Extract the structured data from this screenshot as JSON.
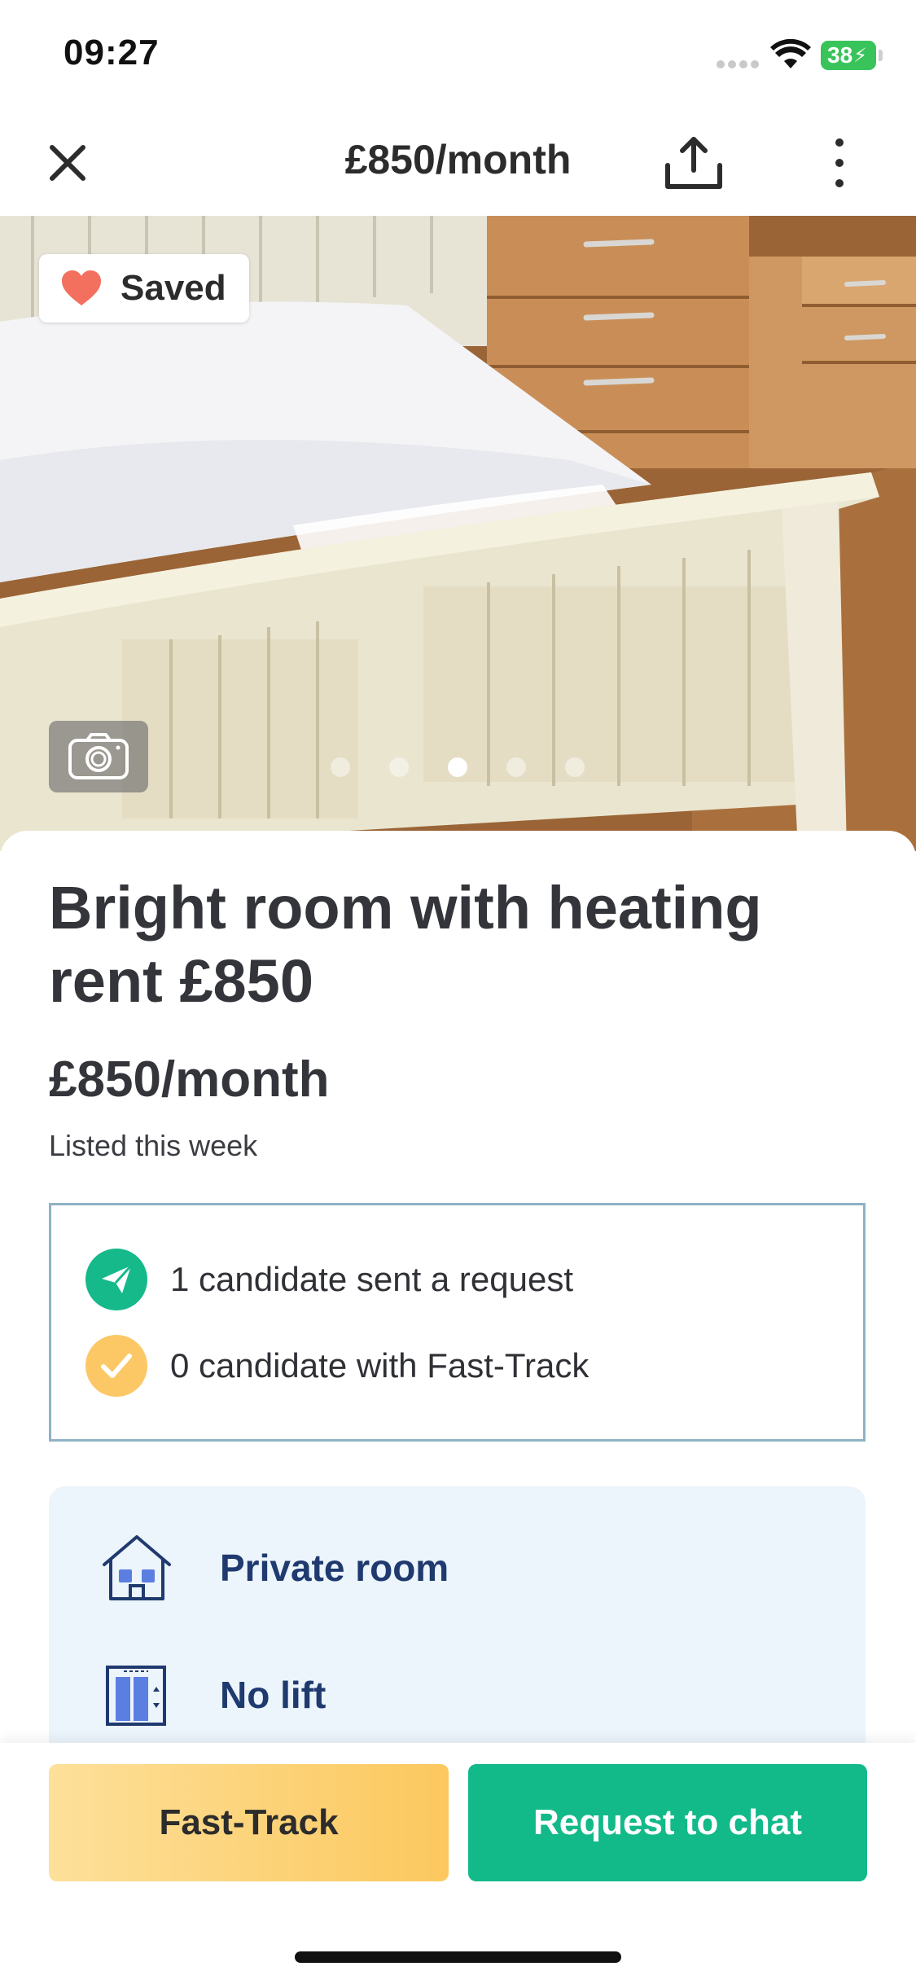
{
  "status_bar": {
    "time": "09:27",
    "battery": "38"
  },
  "header": {
    "title": "£850/month"
  },
  "photo": {
    "saved_label": "Saved",
    "slide_count": 5,
    "active_slide": 3
  },
  "listing": {
    "title": "Bright room with heating rent £850",
    "price": "£850/month",
    "listed": "Listed this week"
  },
  "candidates": [
    {
      "icon": "paper-plane-icon",
      "text": "1 candidate sent a request"
    },
    {
      "icon": "checkmark-icon",
      "text": "0 candidate with Fast-Track"
    }
  ],
  "features": [
    {
      "icon": "house-icon",
      "label": "Private room"
    },
    {
      "icon": "lift-icon",
      "label": "No lift"
    }
  ],
  "actions": {
    "fast_track": "Fast-Track",
    "request_chat": "Request to chat"
  },
  "colors": {
    "accent_green": "#12b989",
    "accent_yellow": "#fcc865",
    "feature_text": "#1f3a6e",
    "saved_heart": "#f2705d"
  }
}
